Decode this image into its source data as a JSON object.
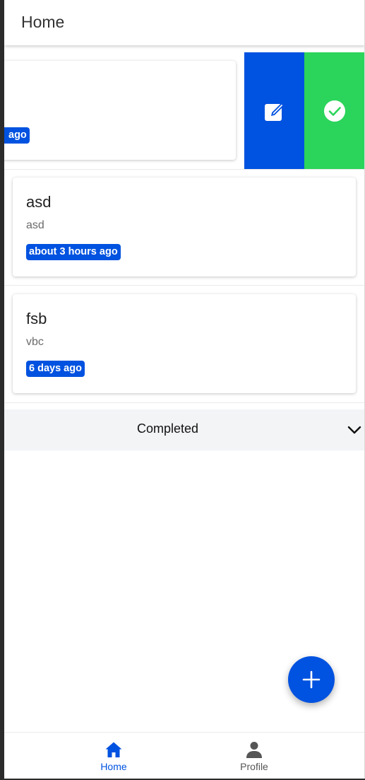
{
  "header": {
    "title": "Home"
  },
  "tasks": [
    {
      "title": "",
      "subtitle": "",
      "time": "ago"
    },
    {
      "title": "asd",
      "subtitle": "asd",
      "time": "about 3 hours ago"
    },
    {
      "title": "fsb",
      "subtitle": "vbc",
      "time": "6 days ago"
    }
  ],
  "swipe_actions": {
    "edit_icon": "edit-icon",
    "complete_icon": "check-circle-icon"
  },
  "completed_section": {
    "label": "Completed",
    "icon": "chevron-down-icon"
  },
  "fab": {
    "icon": "plus-icon"
  },
  "nav": [
    {
      "label": "Home",
      "icon": "home-icon",
      "active": true
    },
    {
      "label": "Profile",
      "icon": "person-icon",
      "active": false
    }
  ],
  "colors": {
    "primary": "#0052e0",
    "success": "#2bd45b",
    "section_bg": "#f3f4f6",
    "nav_inactive": "#555555"
  }
}
